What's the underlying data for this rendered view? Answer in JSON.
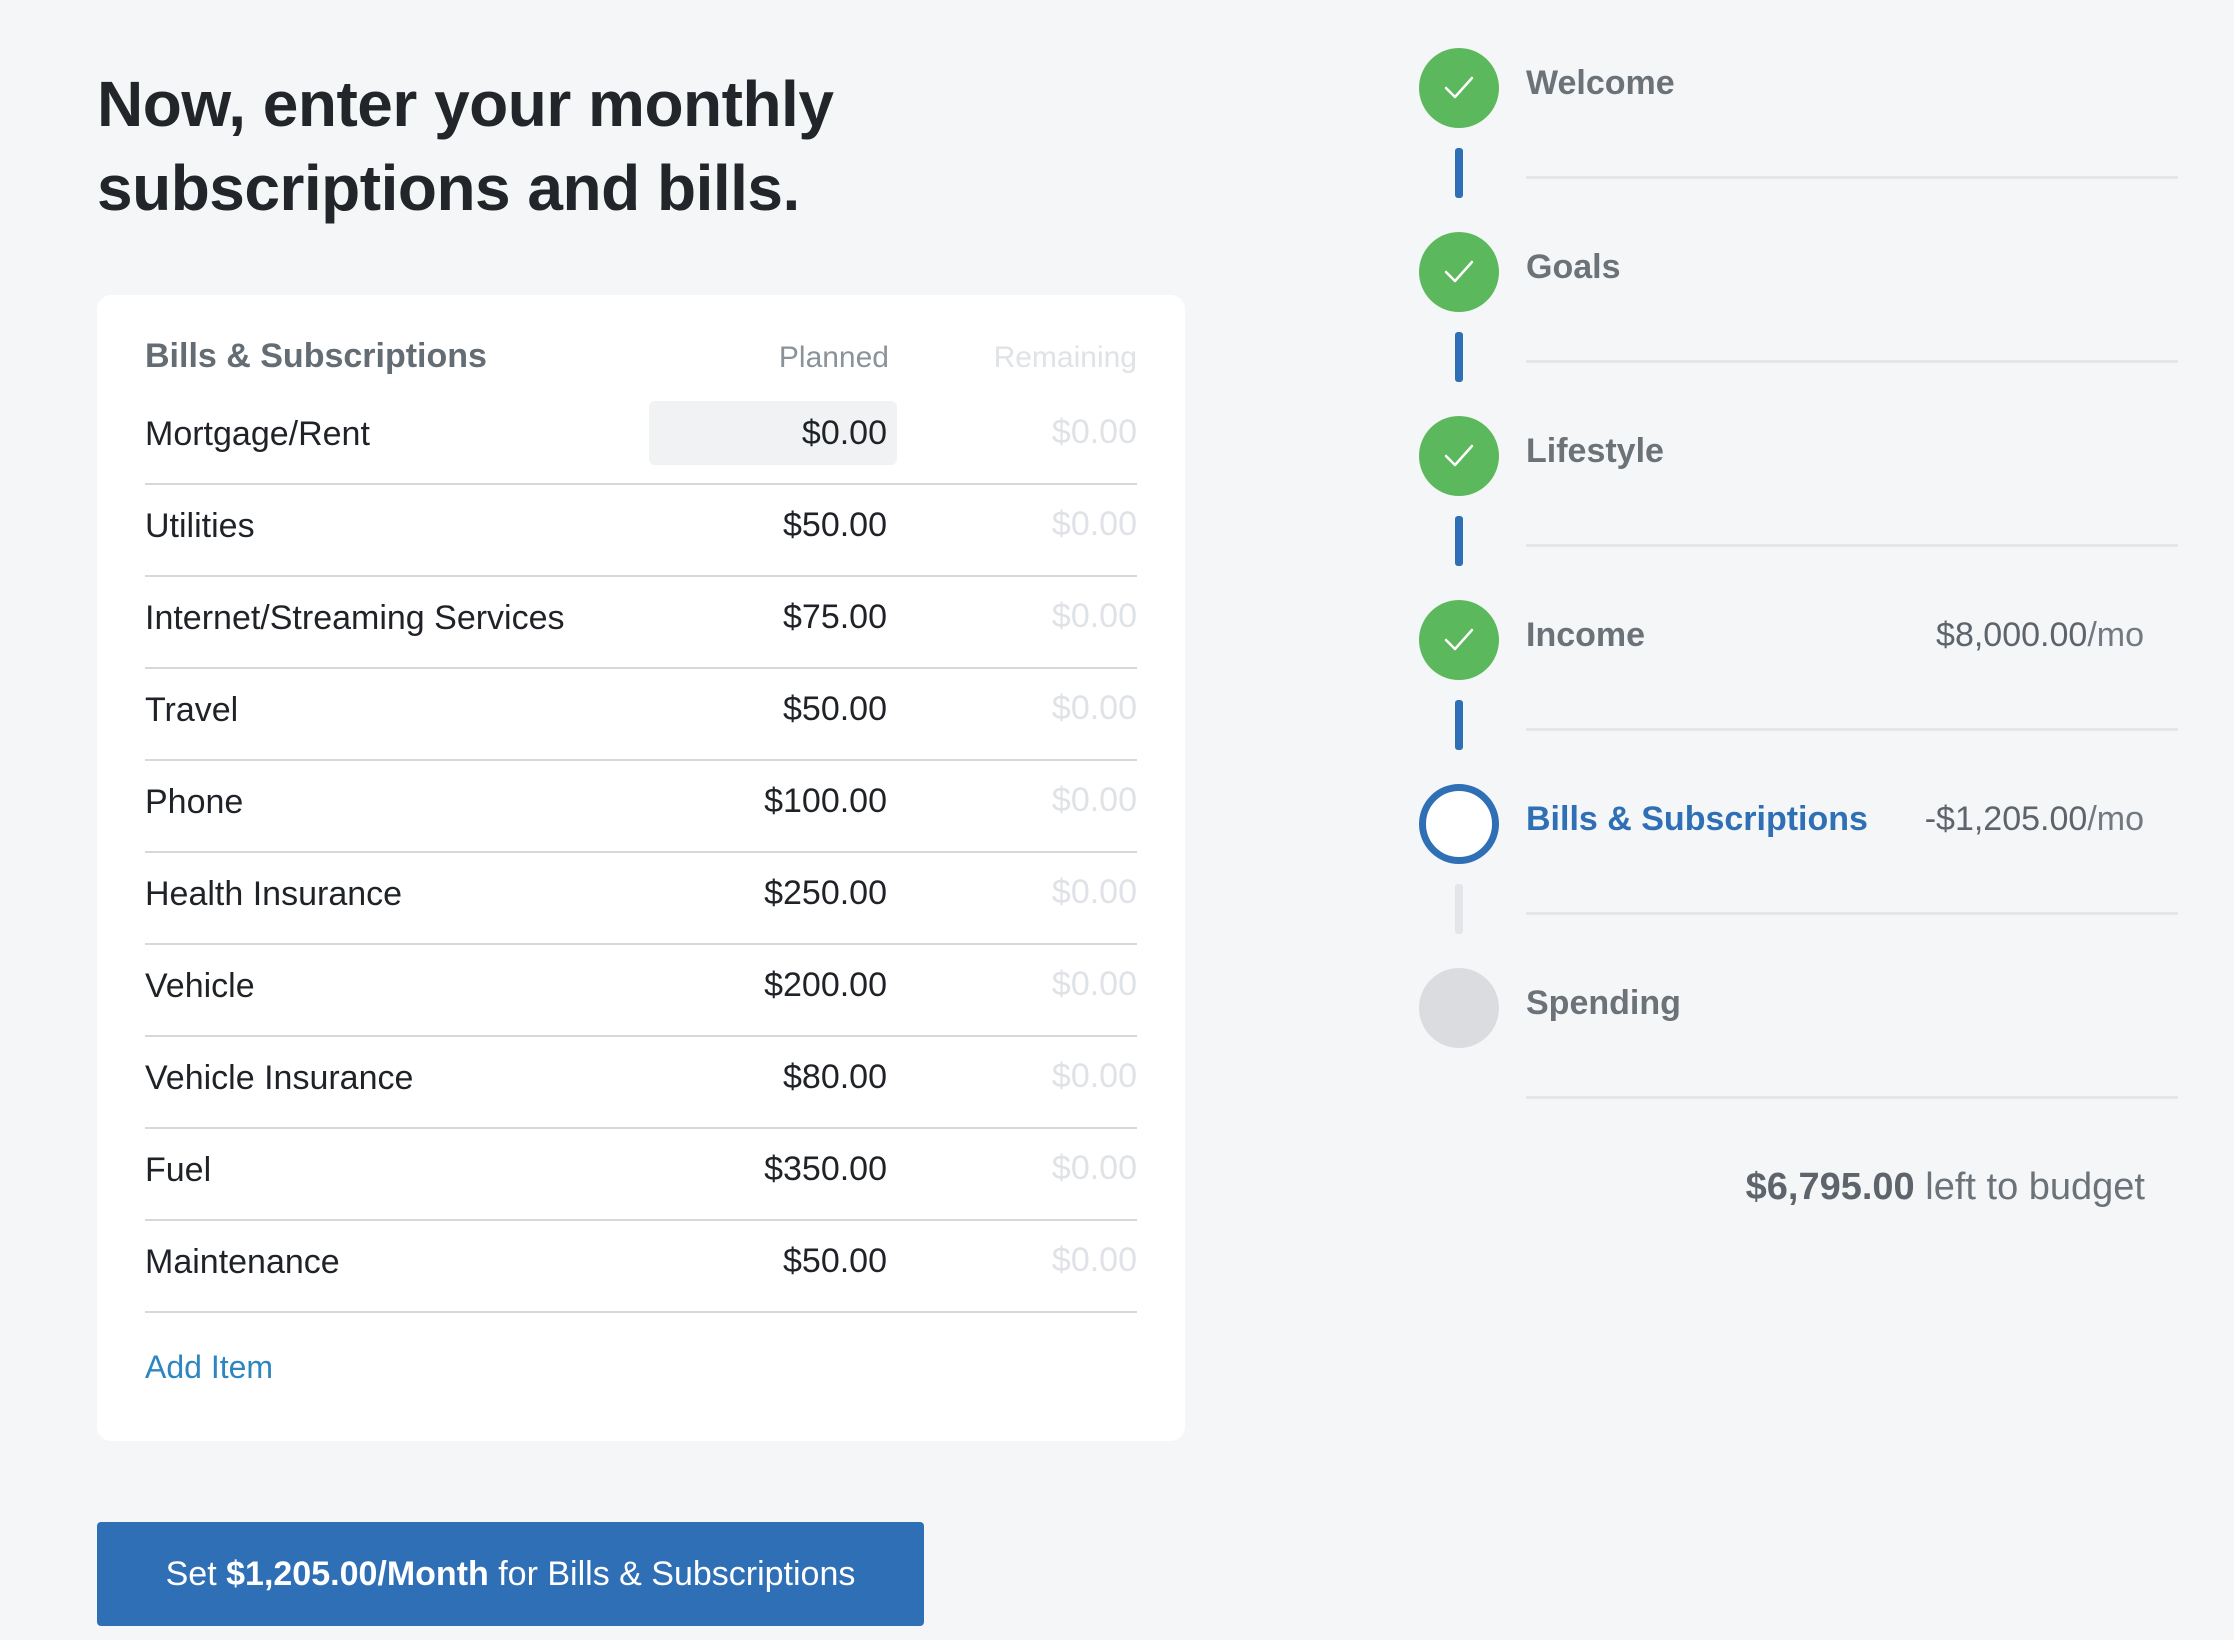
{
  "page": {
    "title": "Now, enter your monthly subscriptions and bills."
  },
  "card": {
    "header": {
      "title": "Bills & Subscriptions",
      "planned_label": "Planned",
      "remaining_label": "Remaining"
    },
    "rows": [
      {
        "name": "Mortgage/Rent",
        "planned": "$0.00",
        "remaining": "$0.00"
      },
      {
        "name": "Utilities",
        "planned": "$50.00",
        "remaining": "$0.00"
      },
      {
        "name": "Internet/Streaming Services",
        "planned": "$75.00",
        "remaining": "$0.00"
      },
      {
        "name": "Travel",
        "planned": "$50.00",
        "remaining": "$0.00"
      },
      {
        "name": "Phone",
        "planned": "$100.00",
        "remaining": "$0.00"
      },
      {
        "name": "Health Insurance",
        "planned": "$250.00",
        "remaining": "$0.00"
      },
      {
        "name": "Vehicle",
        "planned": "$200.00",
        "remaining": "$0.00"
      },
      {
        "name": "Vehicle Insurance",
        "planned": "$80.00",
        "remaining": "$0.00"
      },
      {
        "name": "Fuel",
        "planned": "$350.00",
        "remaining": "$0.00"
      },
      {
        "name": "Maintenance",
        "planned": "$50.00",
        "remaining": "$0.00"
      }
    ],
    "add_item_label": "Add Item"
  },
  "cta": {
    "prefix": "Set",
    "amount": "$1,205.00/Month",
    "suffix": "for Bills & Subscriptions"
  },
  "stepper": {
    "steps": [
      {
        "label": "Welcome",
        "status": "done",
        "amount": "",
        "unit": ""
      },
      {
        "label": "Goals",
        "status": "done",
        "amount": "",
        "unit": ""
      },
      {
        "label": "Lifestyle",
        "status": "done",
        "amount": "",
        "unit": ""
      },
      {
        "label": "Income",
        "status": "done",
        "amount": "$8,000.00",
        "unit": "/mo"
      },
      {
        "label": "Bills & Subscriptions",
        "status": "current",
        "amount": "-$1,205.00",
        "unit": "/mo"
      },
      {
        "label": "Spending",
        "status": "todo",
        "amount": "",
        "unit": ""
      }
    ],
    "left_to_budget": {
      "amount": "$6,795.00",
      "label": "left to budget"
    }
  },
  "colors": {
    "accent": "#2f6fb5",
    "done": "#5cb85c",
    "todo": "#dadcdf",
    "link": "#2e86c1"
  },
  "icons": {
    "done_step": "checkmark-icon"
  }
}
